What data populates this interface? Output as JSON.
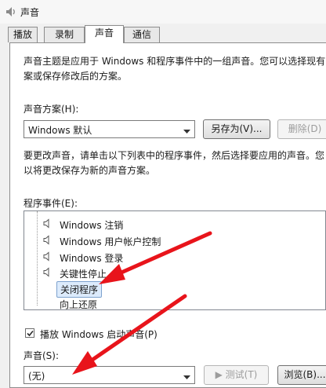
{
  "window": {
    "title": "声音"
  },
  "tabs": [
    {
      "label": "播放"
    },
    {
      "label": "录制"
    },
    {
      "label": "声音",
      "active": true
    },
    {
      "label": "通信"
    }
  ],
  "intro": {
    "line1": "声音主题是应用于 Windows 和程序事件中的一组声音。您可以选择现有",
    "line2": "案或保存修改后的方案。"
  },
  "scheme": {
    "label": "声音方案(H):",
    "selected": "Windows 默认",
    "save_as_label": "另存为(V)...",
    "delete_label": "删除(D)"
  },
  "instructions": {
    "line1": "要更改声音，请单击以下列表中的程序事件，然后选择要应用的声音。您",
    "line2": "以将更改保存为新的声音方案。"
  },
  "events": {
    "label": "程序事件(E):",
    "items": [
      {
        "label": "Windows 注销",
        "has_sound": true
      },
      {
        "label": "Windows 用户帐户控制",
        "has_sound": true
      },
      {
        "label": "Windows 登录",
        "has_sound": true
      },
      {
        "label": "关键性停止",
        "has_sound": true
      },
      {
        "label": "关闭程序",
        "has_sound": false,
        "selected": true
      },
      {
        "label": "向上还原",
        "has_sound": false
      }
    ]
  },
  "startup": {
    "label": "播放 Windows 启动声音(P)",
    "checked": true
  },
  "sounds": {
    "label": "声音(S):",
    "selected": "(无)",
    "test_label": "测试(T)",
    "browse_label": "浏览(B)..."
  },
  "colors": {
    "annotation_arrow": "#e8141b",
    "selection": "#dcebfc"
  }
}
